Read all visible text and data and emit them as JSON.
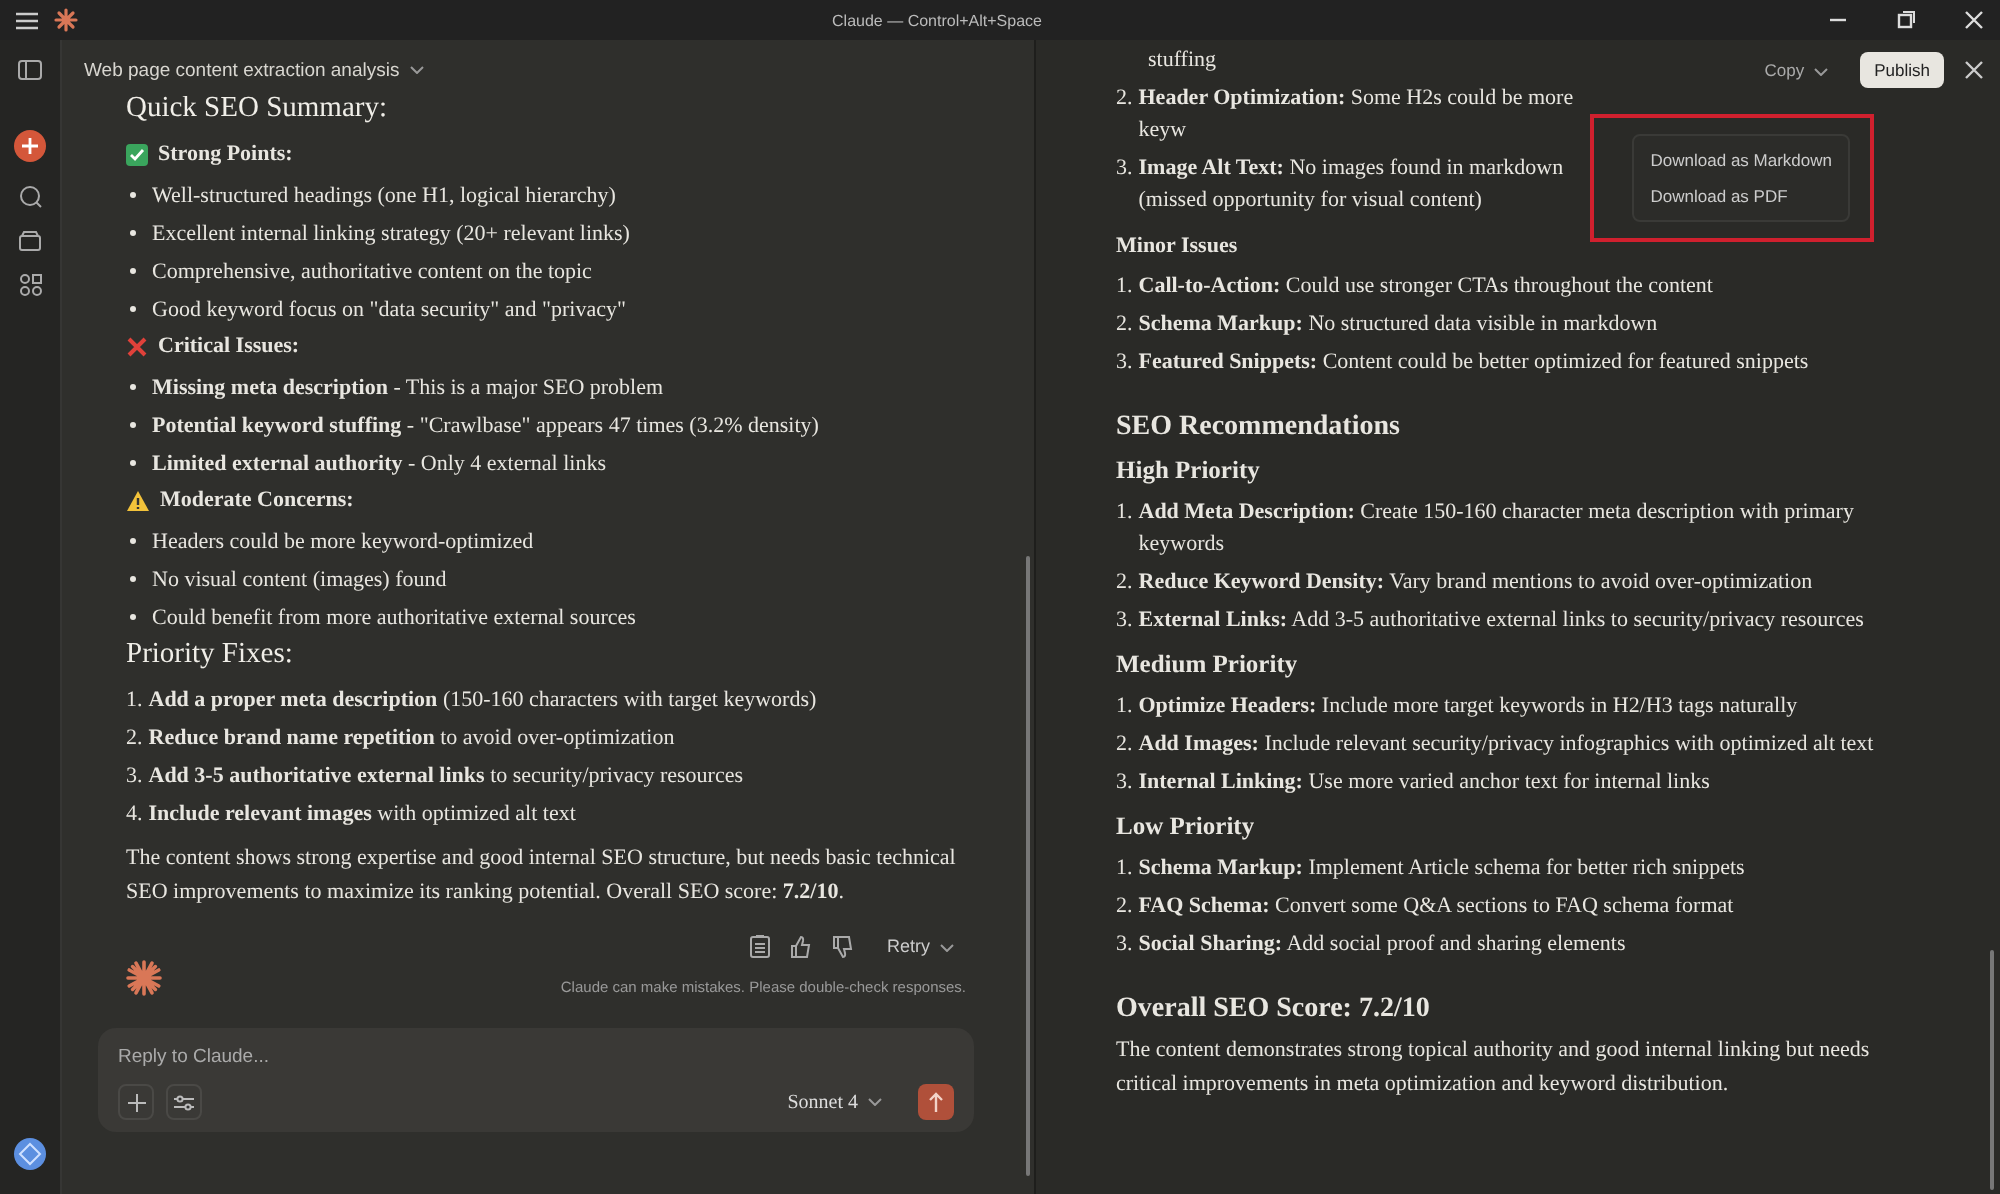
{
  "title_bar": {
    "title": "Claude — Control+Alt+Space"
  },
  "chat": {
    "title": "Web page content extraction analysis",
    "heading": "Quick SEO Summary:",
    "sections": [
      {
        "kind": "good",
        "title": "Strong Points:",
        "bullets": [
          "Well-structured headings (one H1, logical hierarchy)",
          "Excellent internal linking strategy (20+ relevant links)",
          "Comprehensive, authoritative content on the topic",
          "Good keyword focus on \"data security\" and \"privacy\""
        ]
      },
      {
        "kind": "bad",
        "title": "Critical Issues:",
        "bullets": [
          "**Missing meta description** - This is a major SEO problem",
          "**Potential keyword stuffing** - \"Crawlbase\" appears 47 times (3.2% density)",
          "**Limited external authority** - Only 4 external links"
        ]
      },
      {
        "kind": "warn",
        "title": "Moderate Concerns:",
        "bullets": [
          "Headers could be more keyword-optimized",
          "No visual content (images) found",
          "Could benefit from more authoritative external sources"
        ]
      }
    ],
    "fixes_heading": "Priority Fixes:",
    "fixes": [
      {
        "number": "1.",
        "text": "**Add a proper meta description** (150-160 characters with target keywords)"
      },
      {
        "number": "2.",
        "text": "**Reduce brand name repetition** to avoid over-optimization"
      },
      {
        "number": "3.",
        "text": "**Add 3-5 authoritative external links** to security/privacy resources"
      },
      {
        "number": "4.",
        "text": "**Include relevant images** with optimized alt text"
      }
    ],
    "summary": "The content shows strong expertise and good internal SEO structure, but needs basic technical SEO improvements to maximize its ranking potential. Overall SEO score: **7.2/10**.",
    "retry": "Retry",
    "disclaimer": "Claude can make mistakes. Please double-check responses.",
    "composer": {
      "placeholder": "Reply to Claude...",
      "model": "Sonnet 4"
    }
  },
  "artifact": {
    "copy": "Copy",
    "publish": "Publish",
    "menu": [
      "Download as Markdown",
      "Download as PDF"
    ],
    "blocks": [
      {
        "kind": "continuation",
        "text": "stuffing"
      },
      {
        "kind": "list",
        "items": [
          {
            "number": "2.",
            "text": "**Header Optimization:** Some H2s could be more keyw"
          },
          {
            "number": "3.",
            "text": "**Image Alt Text:** No images found in markdown (missed opportunity for visual content)"
          }
        ]
      },
      {
        "kind": "h4",
        "text": "Minor Issues"
      },
      {
        "kind": "list",
        "items": [
          {
            "number": "1.",
            "text": "**Call-to-Action:** Could use stronger CTAs throughout the content"
          },
          {
            "number": "2.",
            "text": "**Schema Markup:** No structured data visible in markdown"
          },
          {
            "number": "3.",
            "text": "**Featured Snippets:** Content could be better optimized for featured snippets"
          }
        ]
      },
      {
        "kind": "h2",
        "text": "SEO Recommendations"
      },
      {
        "kind": "h3",
        "text": "High Priority"
      },
      {
        "kind": "list",
        "items": [
          {
            "number": "1.",
            "text": "**Add Meta Description:** Create 150-160 character meta description with primary keywords"
          },
          {
            "number": "2.",
            "text": "**Reduce Keyword Density:** Vary brand mentions to avoid over-optimization"
          },
          {
            "number": "3.",
            "text": "**External Links:** Add 3-5 authoritative external links to security/privacy resources"
          }
        ]
      },
      {
        "kind": "h3",
        "text": "Medium Priority"
      },
      {
        "kind": "list",
        "items": [
          {
            "number": "1.",
            "text": "**Optimize Headers:** Include more target keywords in H2/H3 tags naturally"
          },
          {
            "number": "2.",
            "text": "**Add Images:** Include relevant security/privacy infographics with optimized alt text"
          },
          {
            "number": "3.",
            "text": "**Internal Linking:** Use more varied anchor text for internal links"
          }
        ]
      },
      {
        "kind": "h3",
        "text": "Low Priority"
      },
      {
        "kind": "list",
        "items": [
          {
            "number": "1.",
            "text": "**Schema Markup:** Implement Article schema for better rich snippets"
          },
          {
            "number": "2.",
            "text": "**FAQ Schema:** Convert some Q&A sections to FAQ schema format"
          },
          {
            "number": "3.",
            "text": "**Social Sharing:** Add social proof and sharing elements"
          }
        ]
      },
      {
        "kind": "h2",
        "text": "Overall SEO Score: 7.2/10"
      },
      {
        "kind": "paragraph",
        "text": "The content demonstrates strong topical authority and good internal linking but needs critical improvements in meta optimization and keyword distribution."
      }
    ]
  }
}
